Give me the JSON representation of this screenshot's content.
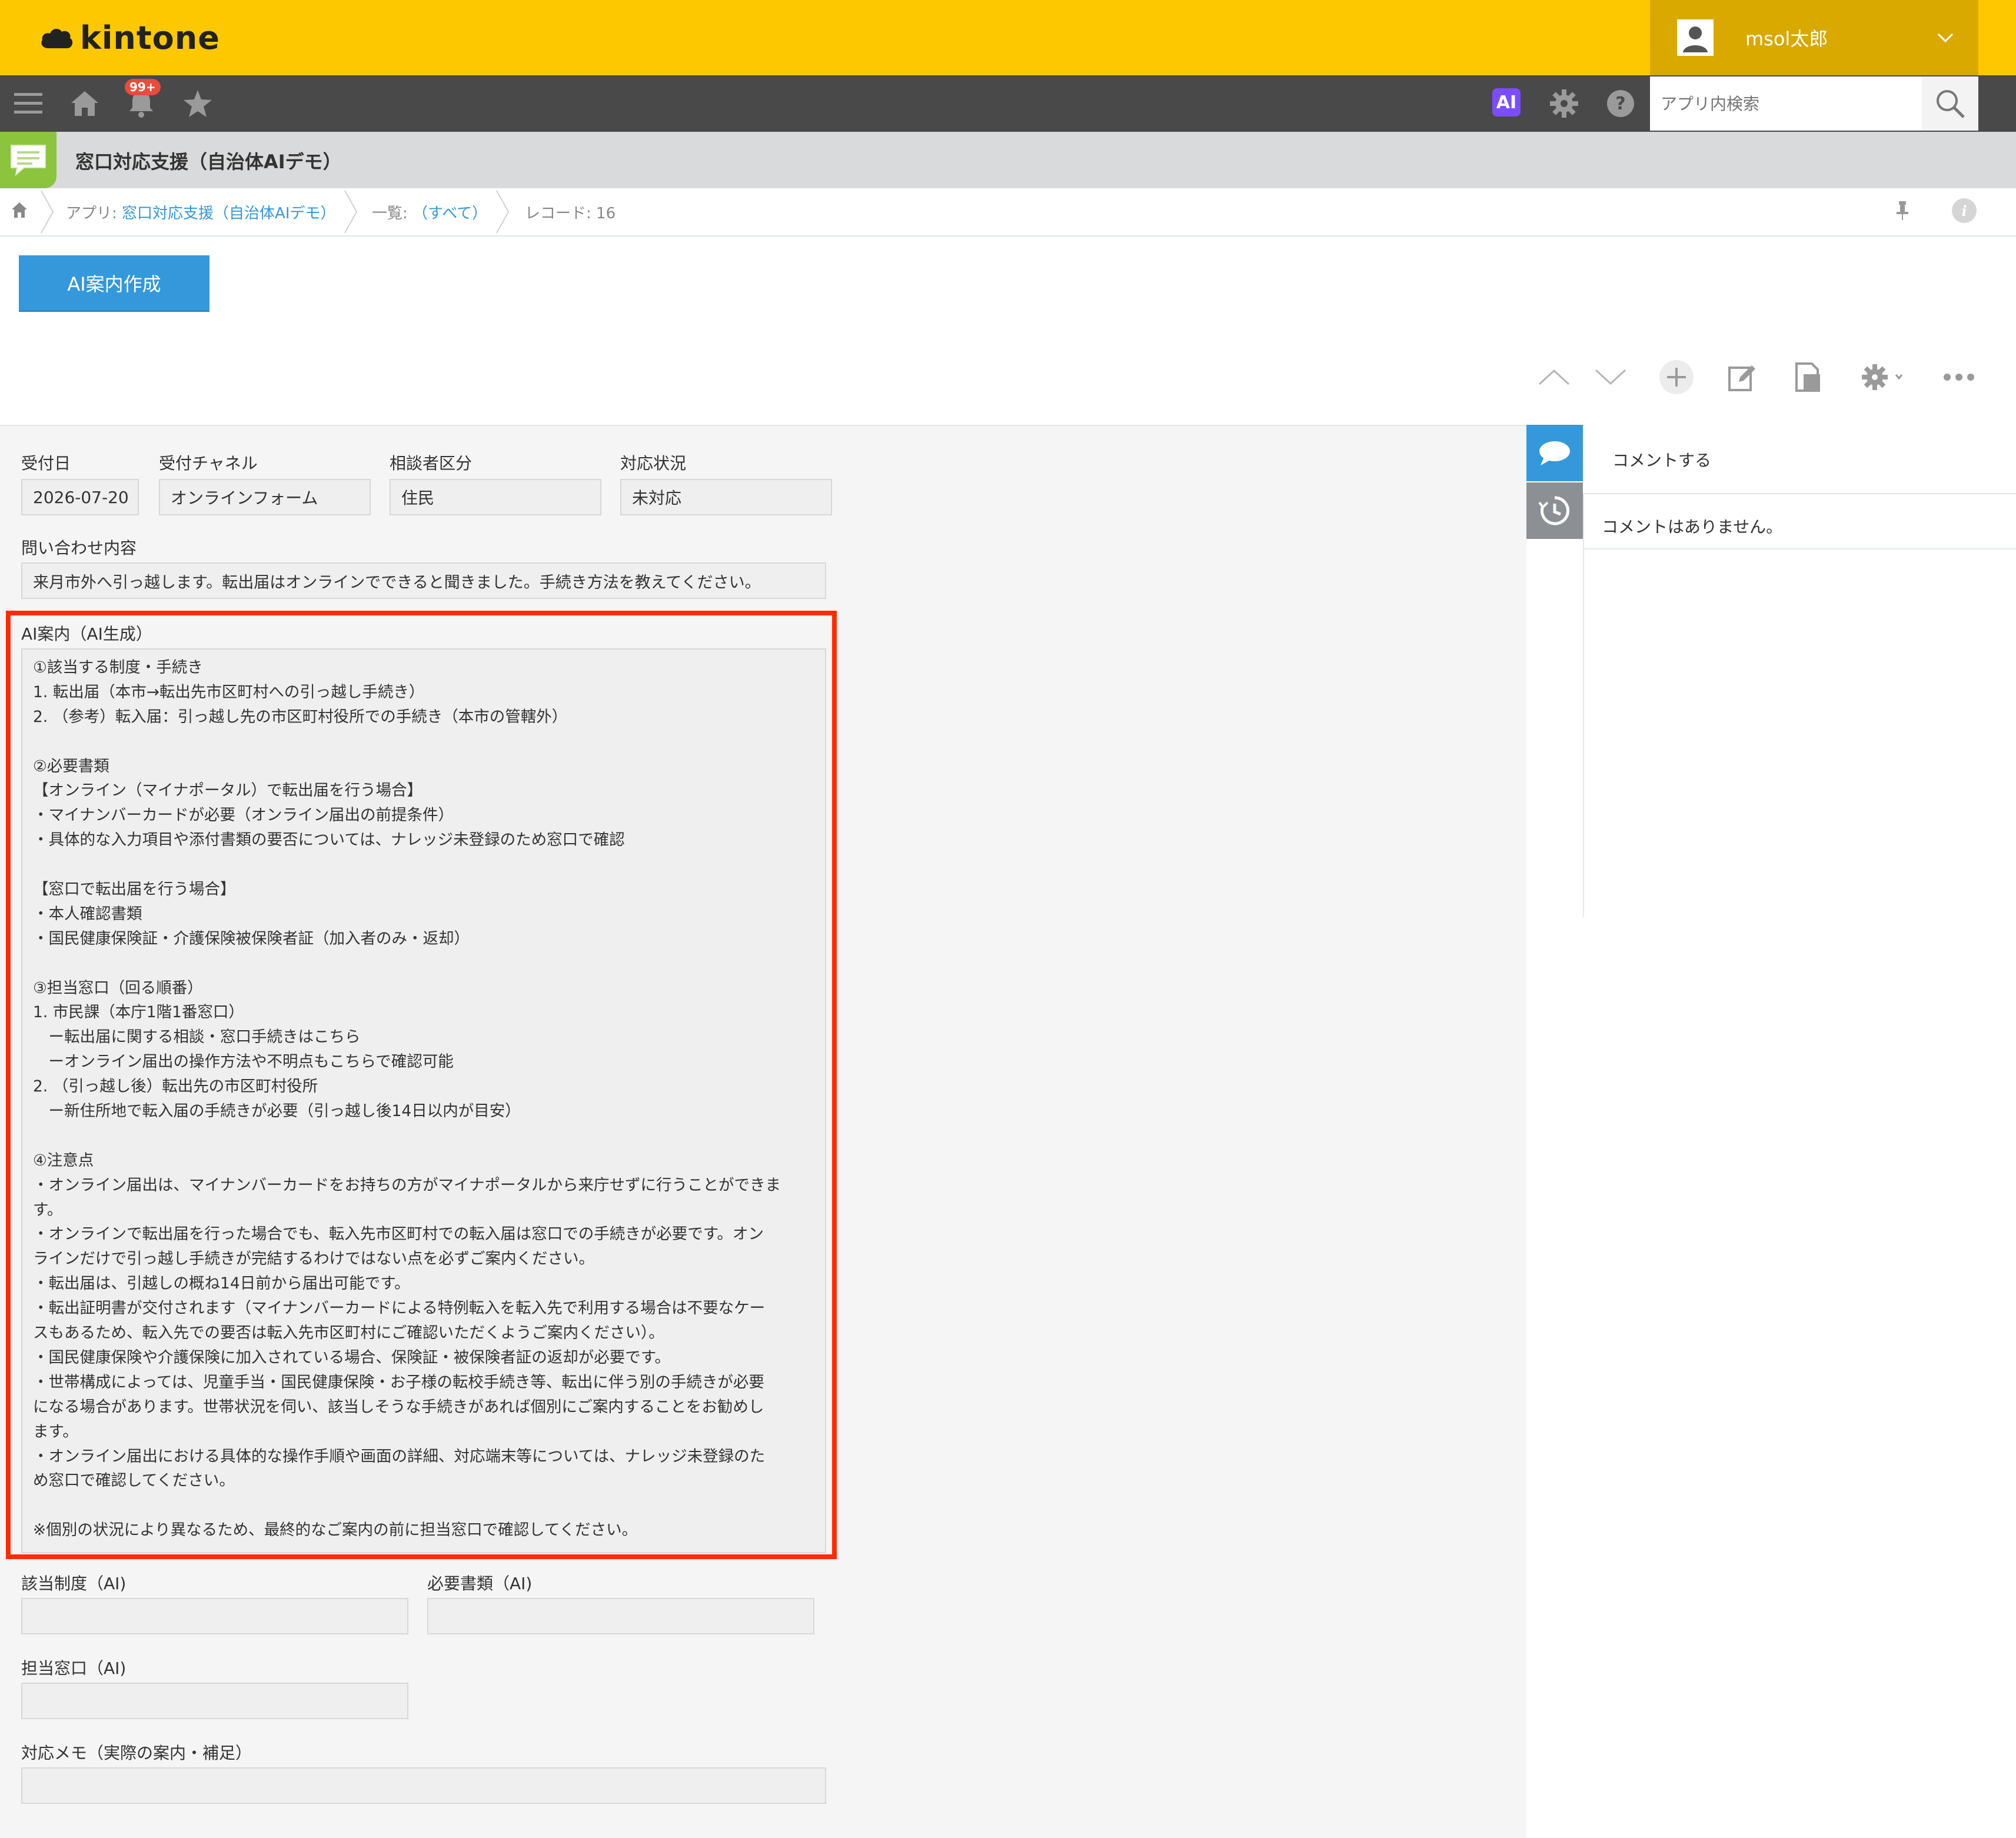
{
  "header": {
    "logo_text": "kintone",
    "user_name": "msol太郎",
    "brand_color": "#fdc800"
  },
  "toolbar": {
    "notification_badge": "99+",
    "ai_label": "AI",
    "search_placeholder": "アプリ内検索",
    "icons": [
      "menu-icon",
      "home-icon",
      "bell-icon",
      "star-icon",
      "gear-icon",
      "help-icon",
      "search-icon"
    ]
  },
  "app": {
    "title": "窓口対応支援（自治体AIデモ）"
  },
  "breadcrumb": {
    "app_prefix": "アプリ: ",
    "app_link": "窓口対応支援（自治体AIデモ）",
    "view_prefix": "一覧: ",
    "view_link": "（すべて）",
    "record": "レコード: 16"
  },
  "actions": {
    "ai_button": "AI案内作成"
  },
  "record": {
    "fields": {
      "reception_date": {
        "label": "受付日",
        "value": "2026-07-20"
      },
      "channel": {
        "label": "受付チャネル",
        "value": "オンラインフォーム"
      },
      "consultant_type": {
        "label": "相談者区分",
        "value": "住民"
      },
      "status": {
        "label": "対応状況",
        "value": "未対応"
      },
      "inquiry": {
        "label": "問い合わせ内容",
        "value": "来月市外へ引っ越します。転出届はオンラインでできると聞きました。手続き方法を教えてください。"
      },
      "ai_guide": {
        "label": "AI案内（AI生成）",
        "lines": [
          "①該当する制度・手続き",
          "1. 転出届（本市→転出先市区町村への引っ越し手続き）",
          "2. （参考）転入届：引っ越し先の市区町村役所での手続き（本市の管轄外）",
          "",
          "②必要書類",
          "【オンライン（マイナポータル）で転出届を行う場合】",
          "・マイナンバーカードが必要（オンライン届出の前提条件）",
          "・具体的な入力項目や添付書類の要否については、ナレッジ未登録のため窓口で確認",
          "",
          "【窓口で転出届を行う場合】",
          "・本人確認書類",
          "・国民健康保険証・介護保険被保険者証（加入者のみ・返却）",
          "",
          "③担当窓口（回る順番）",
          "1. 市民課（本庁1階1番窓口）",
          "　ー転出届に関する相談・窓口手続きはこちら",
          "　ーオンライン届出の操作方法や不明点もこちらで確認可能",
          "2. （引っ越し後）転出先の市区町村役所",
          "　ー新住所地で転入届の手続きが必要（引っ越し後14日以内が目安）",
          "",
          "④注意点",
          "・オンライン届出は、マイナンバーカードをお持ちの方がマイナポータルから来庁せずに行うことができま",
          "す。",
          "・オンラインで転出届を行った場合でも、転入先市区町村での転入届は窓口での手続きが必要です。オン",
          "ラインだけで引っ越し手続きが完結するわけではない点を必ずご案内ください。",
          "・転出届は、引越しの概ね14日前から届出可能です。",
          "・転出証明書が交付されます（マイナンバーカードによる特例転入を転入先で利用する場合は不要なケー",
          "スもあるため、転入先での要否は転入先市区町村にご確認いただくようご案内ください）。",
          "・国民健康保険や介護保険に加入されている場合、保険証・被保険者証の返却が必要です。",
          "・世帯構成によっては、児童手当・国民健康保険・お子様の転校手続き等、転出に伴う別の手続きが必要",
          "になる場合があります。世帯状況を伺い、該当しそうな手続きがあれば個別にご案内することをお勧めし",
          "ます。",
          "・オンライン届出における具体的な操作手順や画面の詳細、対応端末等については、ナレッジ未登録のた",
          "め窓口で確認してください。",
          "",
          "※個別の状況により異なるため、最終的なご案内の前に担当窓口で確認してください。"
        ]
      },
      "ai_system": {
        "label": "該当制度（AI)",
        "value": ""
      },
      "ai_documents": {
        "label": "必要書類（AI)",
        "value": ""
      },
      "ai_counter": {
        "label": "担当窓口（AI)",
        "value": ""
      },
      "memo": {
        "label": "対応メモ（実際の案内・補足）",
        "value": ""
      }
    }
  },
  "comments": {
    "post_placeholder": "コメントする",
    "empty_text": "コメントはありません。"
  }
}
